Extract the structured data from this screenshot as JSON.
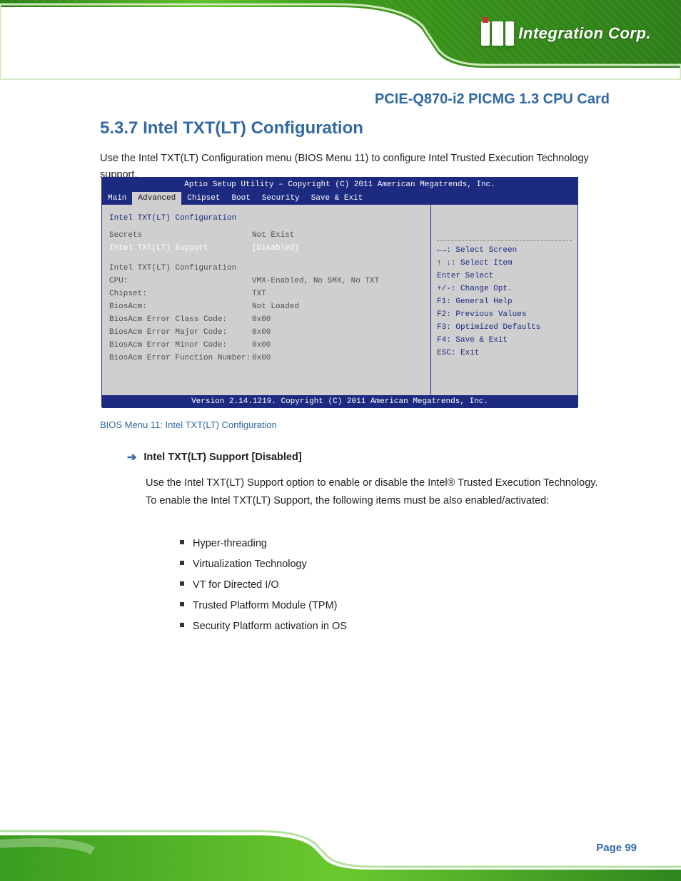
{
  "header": {
    "logo_text": "Integration Corp.",
    "doc_title": "PCIE-Q870-i2 PICMG 1.3 CPU Card"
  },
  "section": {
    "number": "5.3.7",
    "title": "Intel TXT(LT) Configuration"
  },
  "intro": "Use the Intel TXT(LT) Configuration menu (BIOS Menu 11) to configure Intel Trusted Execution Technology support.",
  "bios": {
    "setup_title": "Aptio Setup Utility – Copyright (C) 2011 American Megatrends, Inc.",
    "tabs": [
      "Main",
      "Advanced",
      "Chipset",
      "Boot",
      "Security",
      "Save & Exit"
    ],
    "active_tab": 1,
    "left": {
      "header": "Intel TXT(LT) Configuration",
      "rows": [
        {
          "k": "Secrets",
          "v": "Not Exist"
        },
        {
          "k": "Intel TXT(LT) Support",
          "v": "[Disabled]",
          "sel": true
        },
        {
          "k": "Intel TXT(LT) Configuration",
          "v": ""
        },
        {
          "k": "CPU:",
          "v": "VMX-Enabled, No SMX, No TXT"
        },
        {
          "k": "Chipset:",
          "v": "TXT"
        },
        {
          "k": "BiosAcm:",
          "v": "Not Loaded"
        },
        {
          "k": "BiosAcm Error Class Code:",
          "v": "0x00"
        },
        {
          "k": "BiosAcm Error Major Code:",
          "v": "0x00"
        },
        {
          "k": "BiosAcm Error Minor Code:",
          "v": "0x00"
        },
        {
          "k": "BiosAcm Error Function Number:",
          "v": "0x00"
        }
      ]
    },
    "right": {
      "hint": "",
      "keys": [
        {
          "keylabel": "←→",
          "action": ": Select Screen"
        },
        {
          "keylabel": "↑ ↓",
          "action": ": Select Item"
        },
        {
          "keylabel": "Enter",
          "action": "Select"
        },
        {
          "keylabel": "+/-",
          "action": ": Change Opt."
        },
        {
          "keylabel": "F1",
          "action": ": General Help"
        },
        {
          "keylabel": "F2",
          "action": ": Previous Values"
        },
        {
          "keylabel": "F3",
          "action": ": Optimized Defaults"
        },
        {
          "keylabel": "F4",
          "action": ": Save & Exit"
        },
        {
          "keylabel": "ESC",
          "action": ": Exit"
        }
      ]
    },
    "footer": "Version 2.14.1219. Copyright (C) 2011 American Megatrends, Inc."
  },
  "bios_caption": "BIOS Menu 11: Intel TXT(LT) Configuration",
  "txt_heading": "Intel TXT(LT) Support [Disabled]",
  "para1": "Use the Intel TXT(LT) Support option to enable or disable the Intel® Trusted Execution Technology. To enable the Intel TXT(LT) Support, the following items must be also enabled/activated:",
  "bullets": [
    "Hyper-threading",
    "Virtualization Technology",
    "VT for Directed I/O",
    "Trusted Platform Module (TPM)",
    "Security Platform activation in OS"
  ],
  "page_number": "Page 99"
}
